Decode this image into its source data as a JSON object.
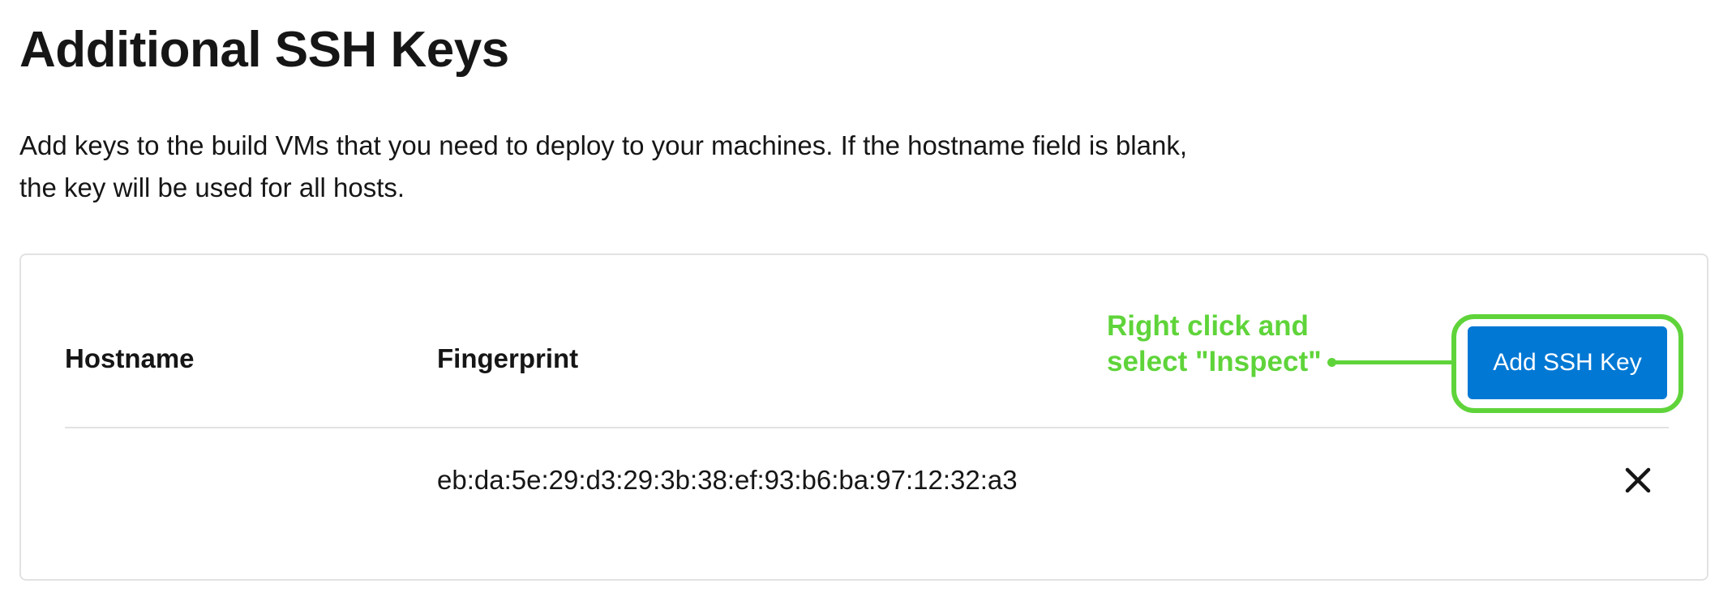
{
  "page": {
    "title": "Additional SSH Keys",
    "description": "Add keys to the build VMs that you need to deploy to your machines. If the hostname field is blank, the key will be used for all hosts."
  },
  "table": {
    "columns": [
      "Hostname",
      "Fingerprint"
    ],
    "add_button_label": "Add SSH Key",
    "rows": [
      {
        "hostname": "",
        "fingerprint": "eb:da:5e:29:d3:29:3b:38:ef:93:b6:ba:97:12:32:a3",
        "delete_icon": "close-icon"
      }
    ]
  },
  "annotation": {
    "text": "Right click and\nselect \"Inspect\"",
    "color": "#5fd43a"
  },
  "colors": {
    "primary_button": "#0078d4",
    "annotation": "#5fd43a",
    "border": "#e2e2e2"
  }
}
